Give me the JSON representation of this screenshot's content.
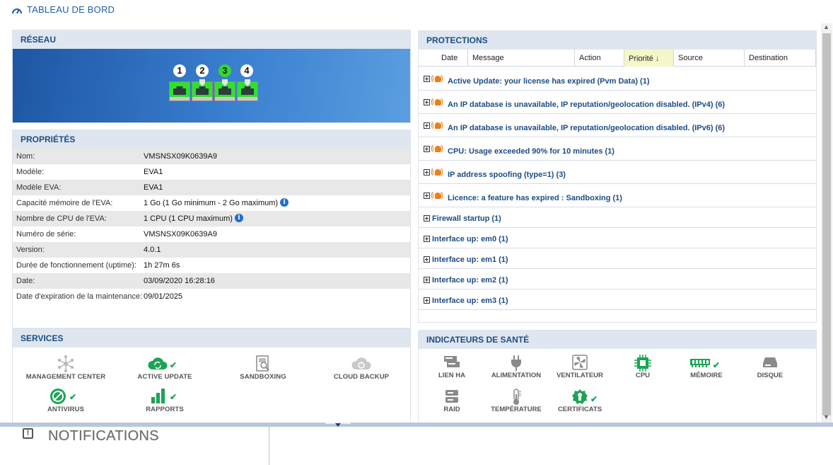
{
  "header": {
    "title": "TABLEAU DE BORD",
    "icon": "gauge-icon"
  },
  "reseau": {
    "title": "RÉSEAU",
    "ports": [
      {
        "number": "1",
        "active": false
      },
      {
        "number": "2",
        "active": false
      },
      {
        "number": "3",
        "active": true
      },
      {
        "number": "4",
        "active": false
      }
    ]
  },
  "proprietes": {
    "title": "PROPRIÉTÉS",
    "rows": [
      {
        "key": "Nom:",
        "value": "VMSNSX09K0639A9"
      },
      {
        "key": "Modèle:",
        "value": "EVA1"
      },
      {
        "key": "Modèle EVA:",
        "value": "EVA1"
      },
      {
        "key": "Capacité mémoire de l'EVA:",
        "value": "1 Go (1 Go minimum - 2 Go maximum)",
        "info": true
      },
      {
        "key": "Nombre de CPU de l'EVA:",
        "value": "1 CPU (1 CPU maximum)",
        "info": true
      },
      {
        "key": "Numéro de série:",
        "value": "VMSNSX09K0639A9"
      },
      {
        "key": "Version:",
        "value": "4.0.1"
      },
      {
        "key": "Durée de fonctionnement (uptime):",
        "value": "1h 27m 6s"
      },
      {
        "key": "Date:",
        "value": "03/09/2020 16:28:16"
      },
      {
        "key": "Date d'expiration de la maintenance:",
        "value": "09/01/2025"
      }
    ]
  },
  "services": {
    "title": "SERVICES",
    "items": [
      {
        "label": "MANAGEMENT CENTER",
        "icon": "network-hub-icon",
        "ok": false
      },
      {
        "label": "ACTIVE UPDATE",
        "icon": "cloud-sync-icon",
        "ok": true
      },
      {
        "label": "SANDBOXING",
        "icon": "sandbox-file-icon",
        "ok": false
      },
      {
        "label": "CLOUD BACKUP",
        "icon": "cloud-backup-icon",
        "ok": false
      },
      {
        "label": "ANTIVIRUS",
        "icon": "antivirus-icon",
        "ok": true
      },
      {
        "label": "RAPPORTS",
        "icon": "bar-chart-icon",
        "ok": true
      }
    ]
  },
  "protections": {
    "title": "PROTECTIONS",
    "columns": [
      "Date",
      "Message",
      "Action",
      "Priorité",
      "Source",
      "Destination"
    ],
    "sorted_column": "Priorité",
    "alarms": [
      {
        "text": "Active Update: your license has expired (Pvm Data) (1)",
        "alert": true
      },
      {
        "text": "An IP database is unavailable, IP reputation/geolocation disabled. (IPv4) (6)",
        "alert": true
      },
      {
        "text": "An IP database is unavailable, IP reputation/geolocation disabled. (IPv6) (6)",
        "alert": true
      },
      {
        "text": "CPU: Usage exceeded 90% for 10 minutes (1)",
        "alert": true
      },
      {
        "text": "IP address spoofing (type=1) (3)",
        "alert": true
      },
      {
        "text": "Licence: a feature has expired : Sandboxing (1)",
        "alert": true
      },
      {
        "text": "Firewall startup (1)",
        "alert": false
      },
      {
        "text": "Interface up: em0 (1)",
        "alert": false
      },
      {
        "text": "Interface up: em1 (1)",
        "alert": false
      },
      {
        "text": "Interface up: em2 (1)",
        "alert": false
      },
      {
        "text": "Interface up: em3 (1)",
        "alert": false
      }
    ]
  },
  "sante": {
    "title": "INDICATEURS DE SANTÉ",
    "items": [
      {
        "label": "LIEN HA",
        "icon": "ha-link-icon",
        "ok": false
      },
      {
        "label": "ALIMENTATION",
        "icon": "power-plug-icon",
        "ok": false
      },
      {
        "label": "VENTILATEUR",
        "icon": "fan-icon",
        "ok": false
      },
      {
        "label": "CPU",
        "icon": "cpu-chip-icon",
        "ok": false
      },
      {
        "label": "MÉMOIRE",
        "icon": "memory-icon",
        "ok": true
      },
      {
        "label": "DISQUE",
        "icon": "disk-icon",
        "ok": false
      },
      {
        "label": "RAID",
        "icon": "raid-icon",
        "ok": false
      },
      {
        "label": "TEMPÉRATURE",
        "icon": "thermometer-icon",
        "ok": false
      },
      {
        "label": "CERTIFICATS",
        "icon": "certificate-icon",
        "ok": true
      }
    ]
  },
  "notifications": {
    "label": "NOTIFICATIONS",
    "icon": "alert-box-icon"
  },
  "colors": {
    "accent": "#1e5ea8",
    "panel_header": "#dfe6ef",
    "ok_green": "#1aa554",
    "alarm_orange": "#f07d17",
    "port_active": "#2fe02f"
  }
}
